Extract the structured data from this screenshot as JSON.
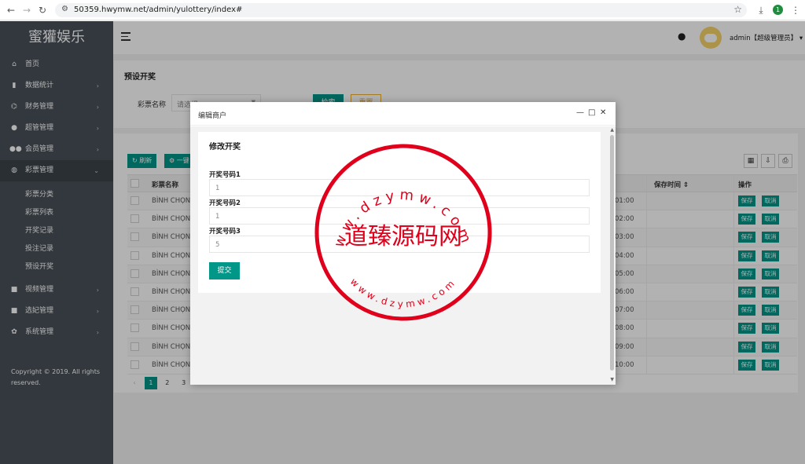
{
  "browser": {
    "url": "50359.hwymw.net/admin/yulottery/index#",
    "ext_badge": "1"
  },
  "sidebar": {
    "brand": "蜜獾娱乐",
    "items": [
      {
        "label": "首页",
        "icon": "home-icon"
      },
      {
        "label": "数据统计",
        "icon": "bar-chart-icon"
      },
      {
        "label": "财务管理",
        "icon": "bank-icon"
      },
      {
        "label": "超管管理",
        "icon": "user-icon"
      },
      {
        "label": "会员管理",
        "icon": "users-icon"
      },
      {
        "label": "彩票管理",
        "icon": "gamepad-icon"
      }
    ],
    "sub_items": [
      "彩票分类",
      "彩票列表",
      "开奖记录",
      "投注记录",
      "预设开奖"
    ],
    "items_after": [
      {
        "label": "视频管理",
        "icon": "video-icon"
      },
      {
        "label": "选妃管理",
        "icon": "video-icon"
      },
      {
        "label": "系统管理",
        "icon": "gear-icon"
      }
    ],
    "copyright": "Copyright © 2019. All rights reserved."
  },
  "header": {
    "user": "admin【超级管理员】"
  },
  "search_card": {
    "title": "预设开奖",
    "field_label": "彩票名称",
    "select_placeholder": "请选择",
    "search_btn": "检索",
    "reset_btn": "重置"
  },
  "table": {
    "refresh_btn": "刷新",
    "batch_btn": "一键",
    "header": {
      "name": "彩票名称",
      "save_time": "保存时间",
      "ops": "操作"
    },
    "rows": [
      {
        "name": "BÌNH CHỌN",
        "time": "01:00"
      },
      {
        "name": "BÌNH CHỌN",
        "time": "02:00"
      },
      {
        "name": "BÌNH CHỌN",
        "time": "03:00"
      },
      {
        "name": "BÌNH CHỌN",
        "time": "04:00"
      },
      {
        "name": "BÌNH CHỌN",
        "time": "05:00"
      },
      {
        "name": "BÌNH CHỌN",
        "time": "06:00"
      },
      {
        "name": "BÌNH CHỌN",
        "time": "07:00"
      },
      {
        "name": "BÌNH CHỌN",
        "time": "08:00"
      },
      {
        "name": "BÌNH CHỌN",
        "time": "09:00"
      },
      {
        "name": "BÌNH CHỌN",
        "time": "10:00"
      }
    ],
    "save_btn": "保存",
    "cancel_btn": "取消",
    "pager": [
      "1",
      "2",
      "3",
      "..."
    ]
  },
  "modal": {
    "title": "编辑商户",
    "form_title": "修改开奖",
    "fields": [
      {
        "label": "开奖号码1",
        "value": "1"
      },
      {
        "label": "开奖号码2",
        "value": "1"
      },
      {
        "label": "开奖号码3",
        "value": "5"
      }
    ],
    "submit": "提交"
  },
  "watermark": {
    "center_text": "道臻源码网",
    "color": "#e0001b"
  },
  "colors": {
    "primary": "#009688",
    "sidebar": "#495159",
    "warning": "#f0a020"
  }
}
